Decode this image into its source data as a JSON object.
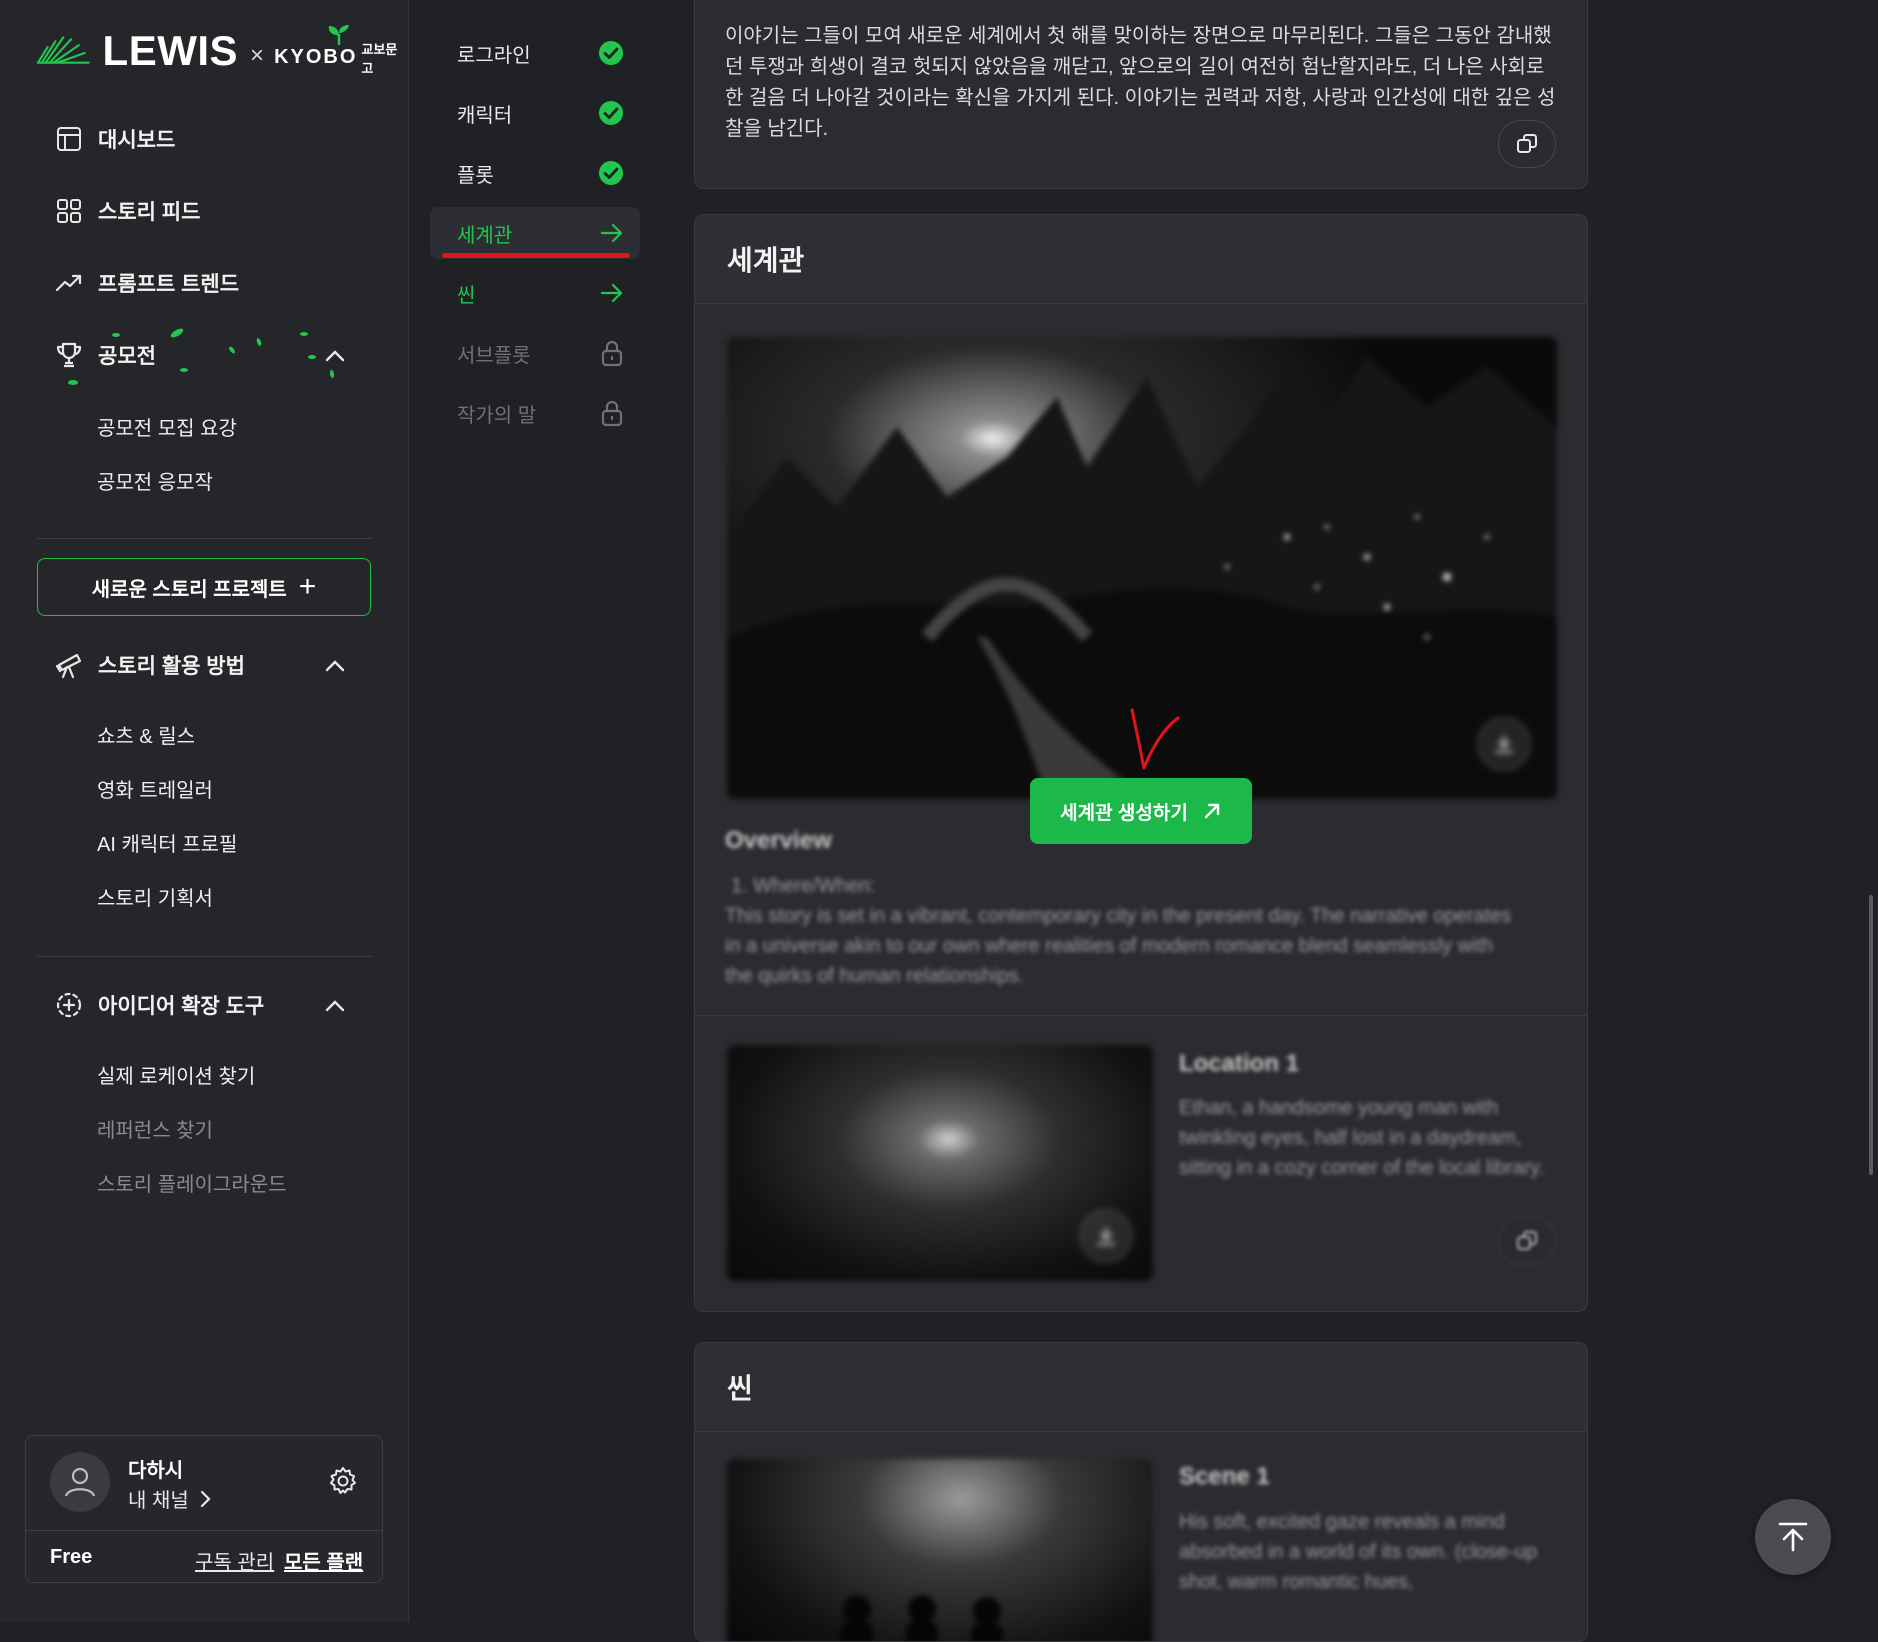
{
  "brand": {
    "name": "LEWIS",
    "x": "×",
    "partner": "KYOBO",
    "partner_sub": "교보문고"
  },
  "colors": {
    "accent": "#22c64f",
    "button": "#1cb84a",
    "mark": "#e0141b",
    "bg": "#202124"
  },
  "sidebar": {
    "nav": [
      {
        "label": "대시보드",
        "icon": "dashboard-icon"
      },
      {
        "label": "스토리 피드",
        "icon": "grid-icon"
      },
      {
        "label": "프롬프트 트렌드",
        "icon": "trend-icon"
      },
      {
        "label": "공모전",
        "icon": "trophy-icon"
      }
    ],
    "contest_items": [
      "공모전 모집 요강",
      "공모전 응모작"
    ],
    "new_project": "새로운 스토리 프로젝트",
    "usage": {
      "label": "스토리 활용 방법",
      "items": [
        "쇼츠 & 릴스",
        "영화 트레일러",
        "AI 캐릭터 프로필",
        "스토리 기획서"
      ]
    },
    "ideas": {
      "label": "아이디어 확장 도구",
      "items": [
        "실제 로케이션 찾기",
        "레퍼런스 찾기",
        "스토리 플레이그라운드"
      ]
    },
    "user": {
      "name": "다하시",
      "channel": "내 채널",
      "plan": "Free",
      "manage": "구독 관리",
      "all_plans": "모든 플랜"
    }
  },
  "steps": [
    {
      "label": "로그라인",
      "state": "done"
    },
    {
      "label": "캐릭터",
      "state": "done"
    },
    {
      "label": "플롯",
      "state": "done"
    },
    {
      "label": "세계관",
      "state": "active"
    },
    {
      "label": "씬",
      "state": "next"
    },
    {
      "label": "서브플롯",
      "state": "locked"
    },
    {
      "label": "작가의 말",
      "state": "locked"
    }
  ],
  "plot_text": "이야기는 그들이 모여 새로운 세계에서 첫 해를 맞이하는 장면으로 마무리된다. 그들은 그동안 감내했던 투쟁과 희생이 결코 헛되지 않았음을 깨닫고, 앞으로의 길이 여전히 험난할지라도, 더 나은 사회로 한 걸음 더 나아갈 것이라는 확신을 가지게 된다. 이야기는 권력과 저항, 사랑과 인간성에 대한 깊은 성찰을 남긴다.",
  "world": {
    "title": "세계관",
    "overview_title": "Overview",
    "overview_sub": "1. Where/When:",
    "overview_text": "This story is set in a vibrant, contemporary city in the present day. The narrative operates in a universe akin to our own where realities of modern romance blend seamlessly with the quirks of human relationships.",
    "location_title": "Location 1",
    "location_text": "Ethan, a handsome young man with twinkling eyes, half lost in a daydream, sitting in a cozy corner of the local library.",
    "generate": "세계관 생성하기"
  },
  "scene": {
    "title": "씬",
    "scene_title": "Scene 1",
    "scene_text": "His soft, excited gaze reveals a mind absorbed in a world of its own. (close-up shot, warm romantic hues,"
  }
}
